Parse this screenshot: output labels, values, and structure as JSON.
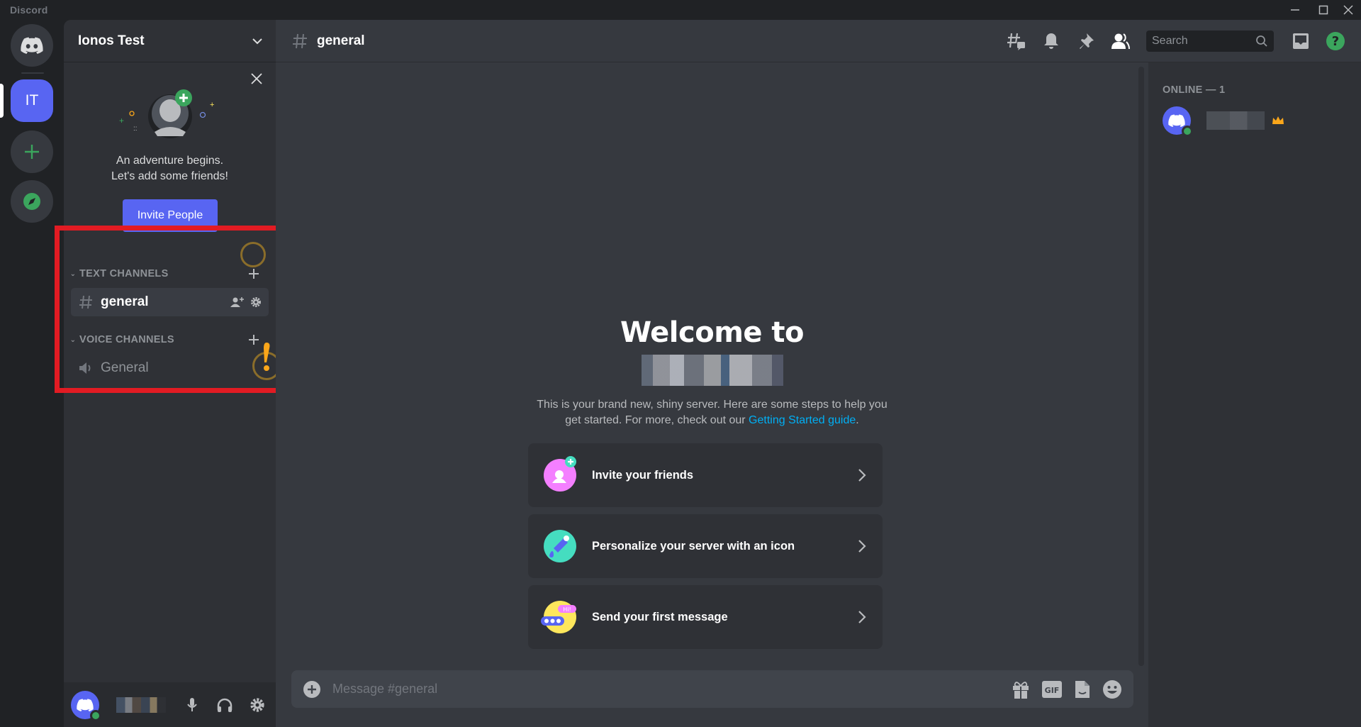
{
  "app": {
    "name": "Discord"
  },
  "window_controls": {
    "minimize": "minimize",
    "maximize": "maximize",
    "close": "close"
  },
  "rail": {
    "home_label": "Direct Messages",
    "servers": [
      {
        "initials": "IT",
        "name": "Ionos Test",
        "selected": true
      }
    ],
    "add_server_label": "Add a Server",
    "explore_label": "Explore Public Servers"
  },
  "sidebar": {
    "server_name": "Ionos Test",
    "invite_card": {
      "line1": "An adventure begins.",
      "line2": "Let's add some friends!",
      "button": "Invite People"
    },
    "categories": [
      {
        "name": "TEXT CHANNELS",
        "channels": [
          {
            "name": "general",
            "type": "text",
            "active": true
          }
        ]
      },
      {
        "name": "VOICE CHANNELS",
        "channels": [
          {
            "name": "General",
            "type": "voice",
            "active": false
          }
        ]
      }
    ]
  },
  "userbar": {
    "username": "[pixelated]",
    "status": "online"
  },
  "header": {
    "channel_name": "general",
    "search_placeholder": "Search",
    "icons": [
      "threads-icon",
      "notification-bell-icon",
      "pinned-messages-icon",
      "member-list-icon",
      "inbox-icon",
      "help-icon"
    ]
  },
  "welcome": {
    "title": "Welcome to",
    "server_name": "[pixelated]",
    "text": "This is your brand new, shiny server. Here are some steps to help you get started. For more, check out our ",
    "link": "Getting Started guide",
    "text_end": ".",
    "cards": [
      {
        "label": "Invite your friends",
        "icon": "invite-friends-icon",
        "color": "#f47fff"
      },
      {
        "label": "Personalize your server with an icon",
        "icon": "personalize-icon",
        "color": "#45ddc0"
      },
      {
        "label": "Send your first message",
        "icon": "first-message-icon",
        "color": "#fee75c"
      }
    ]
  },
  "composer": {
    "placeholder": "Message #general"
  },
  "members": {
    "heading": "ONLINE — 1",
    "list": [
      {
        "name": "[pixelated]",
        "owner": true,
        "status": "online"
      }
    ]
  },
  "annotations": {
    "highlight_color": "#e21b23"
  },
  "colors": {
    "brand": "#5865f2",
    "online": "#3ba55d",
    "link": "#00aff4"
  }
}
